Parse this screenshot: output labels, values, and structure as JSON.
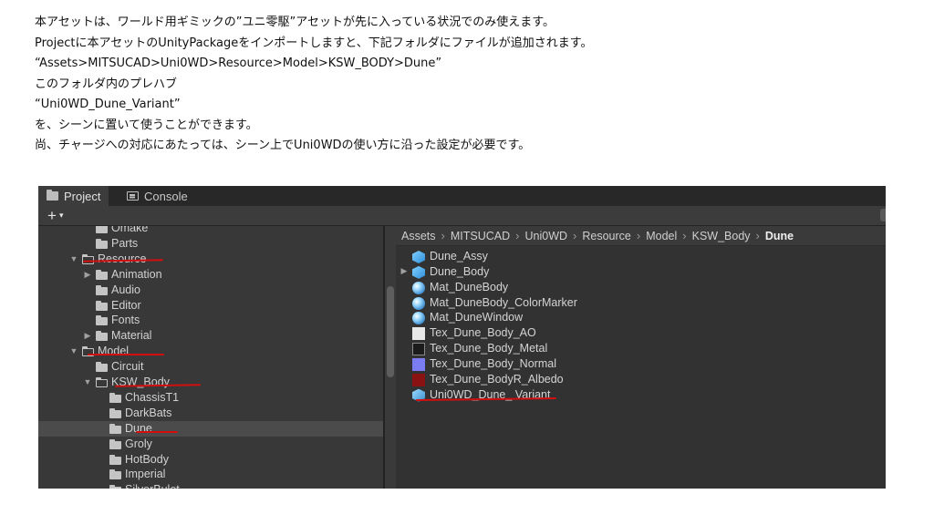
{
  "doc": {
    "lines": [
      "本アセットは、ワールド用ギミックの”ユニ零駆”アセットが先に入っている状況でのみ使えます。",
      "Projectに本アセットのUnityPackageをインポートしますと、下記フォルダにファイルが追加されます。",
      "“Assets>MITSUCAD>Uni0WD>Resource>Model>KSW_BODY>Dune”",
      "このフォルダ内のプレハブ",
      "“Uni0WD_Dune_Variant”",
      "を、シーンに置いて使うことができます。",
      "尚、チャージへの対応にあたっては、シーン上でUni0WDの使い方に沿った設定が必要です。"
    ]
  },
  "unity": {
    "tabs": [
      {
        "label": "Project",
        "icon": "folder-icon"
      },
      {
        "label": "Console",
        "icon": "console-icon"
      }
    ],
    "toolbar": {
      "add_label": "+",
      "add_caret": "▾"
    },
    "tree": [
      {
        "label": "Omake",
        "arrow": ""
      },
      {
        "label": "Parts",
        "arrow": ""
      },
      {
        "label": "Resource",
        "arrow": "▼"
      },
      {
        "label": "Animation",
        "arrow": "▶"
      },
      {
        "label": "Audio",
        "arrow": ""
      },
      {
        "label": "Editor",
        "arrow": ""
      },
      {
        "label": "Fonts",
        "arrow": ""
      },
      {
        "label": "Material",
        "arrow": "▶"
      },
      {
        "label": "Model",
        "arrow": "▼"
      },
      {
        "label": "Circuit",
        "arrow": ""
      },
      {
        "label": "KSW_Body",
        "arrow": "▼"
      },
      {
        "label": "ChassisT1",
        "arrow": ""
      },
      {
        "label": "DarkBats",
        "arrow": ""
      },
      {
        "label": "Dune",
        "arrow": "",
        "selected": true
      },
      {
        "label": "Groly",
        "arrow": ""
      },
      {
        "label": "HotBody",
        "arrow": ""
      },
      {
        "label": "Imperial",
        "arrow": ""
      },
      {
        "label": "SilverBulet",
        "arrow": ""
      }
    ],
    "breadcrumb": [
      "Assets",
      "MITSUCAD",
      "Uni0WD",
      "Resource",
      "Model",
      "KSW_Body",
      "Dune"
    ],
    "assets": [
      {
        "label": "Dune_Assy",
        "icon": "prefab-icon",
        "arrow": ""
      },
      {
        "label": "Dune_Body",
        "icon": "prefab-icon",
        "arrow": "▶"
      },
      {
        "label": "Mat_DuneBody",
        "icon": "material-icon",
        "arrow": ""
      },
      {
        "label": "Mat_DuneBody_ColorMarker",
        "icon": "material-icon",
        "arrow": ""
      },
      {
        "label": "Mat_DuneWindow",
        "icon": "material-icon",
        "arrow": ""
      },
      {
        "label": "Tex_Dune_Body_AO",
        "icon": "texture-ao-icon",
        "arrow": ""
      },
      {
        "label": "Tex_Dune_Body_Metal",
        "icon": "texture-metal-icon",
        "arrow": ""
      },
      {
        "label": "Tex_Dune_Body_Normal",
        "icon": "texture-normal-icon",
        "arrow": ""
      },
      {
        "label": "Tex_Dune_BodyR_Albedo",
        "icon": "texture-albedo-icon",
        "arrow": ""
      },
      {
        "label": "Uni0WD_Dune_ Variant",
        "icon": "prefab-variant-icon",
        "arrow": ""
      }
    ],
    "colors": {
      "annotation": "#d10f0f",
      "panel": "#383838",
      "selection": "#4b4b4b"
    }
  }
}
